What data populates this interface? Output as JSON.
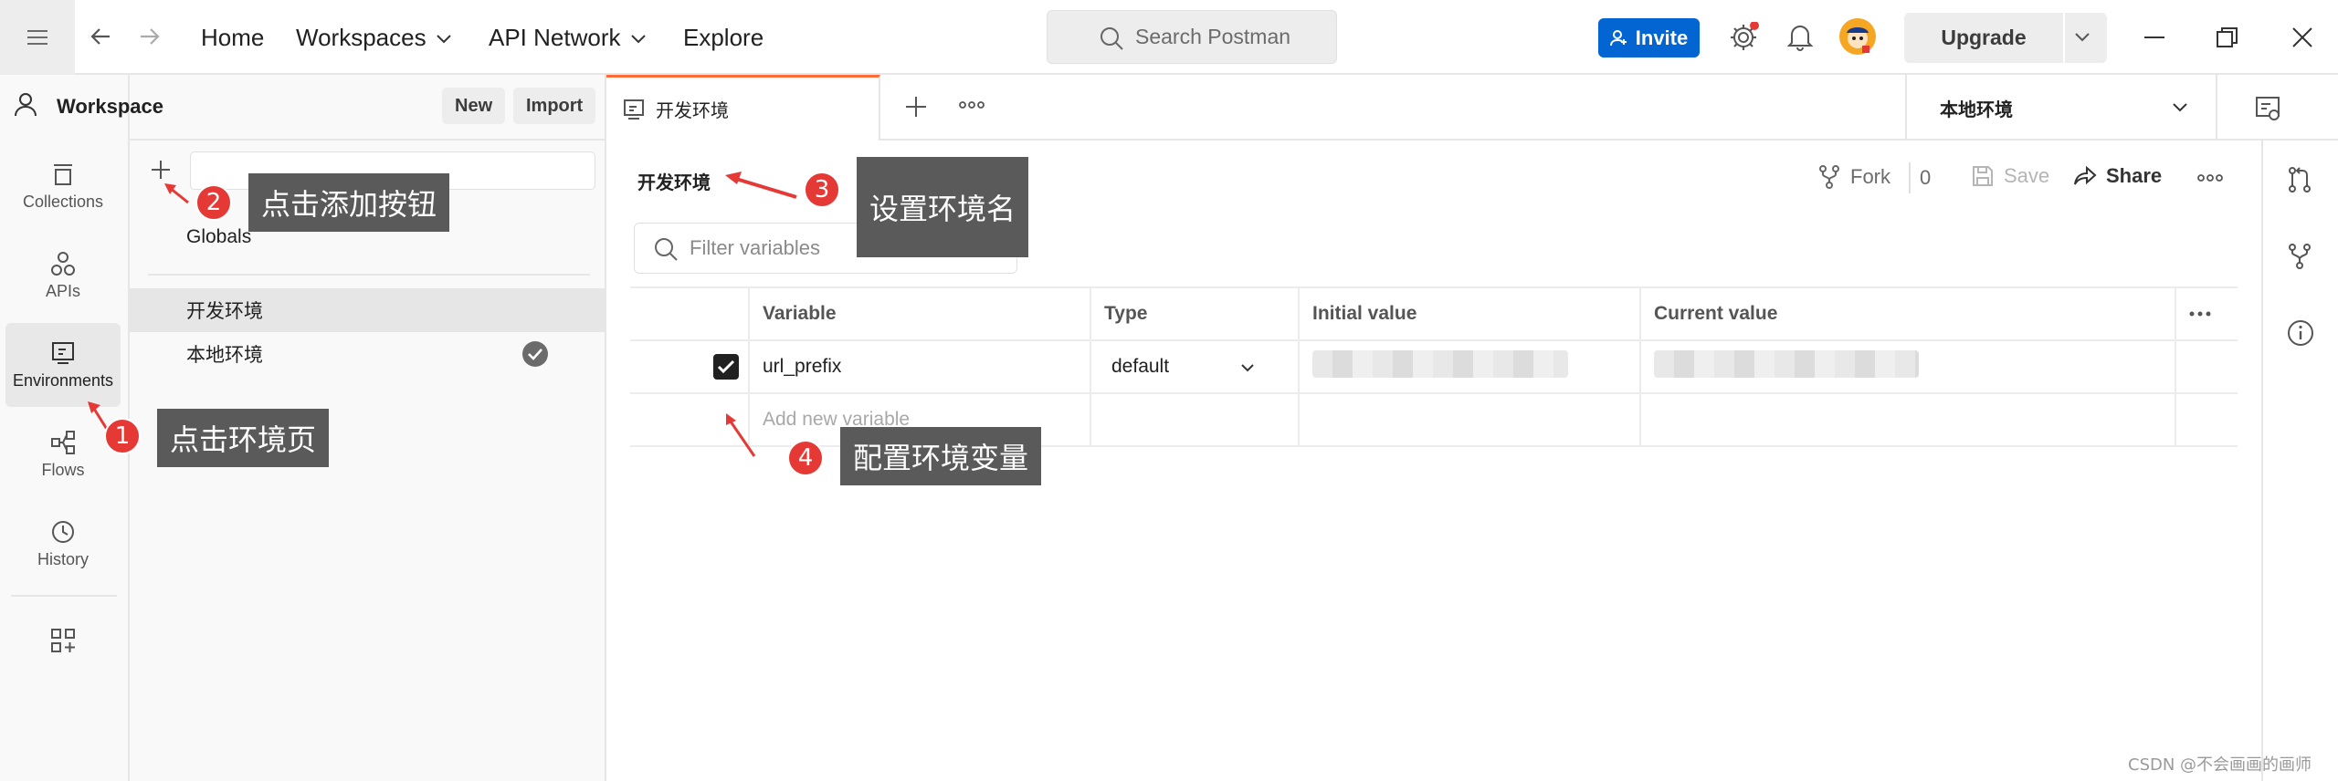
{
  "topbar": {
    "nav": [
      "Home",
      "Workspaces",
      "API Network",
      "Explore"
    ],
    "search_placeholder": "Search Postman",
    "invite_label": "Invite",
    "upgrade_label": "Upgrade",
    "accent_color": "#ff6c37",
    "invite_color": "#0265d2"
  },
  "sidebar": {
    "workspace_label": "Workspace",
    "new_label": "New",
    "import_label": "Import",
    "rail": [
      {
        "label": "Collections",
        "icon": "collections-icon"
      },
      {
        "label": "APIs",
        "icon": "apis-icon"
      },
      {
        "label": "Environments",
        "icon": "environments-icon",
        "active": true
      },
      {
        "label": "Flows",
        "icon": "flows-icon"
      },
      {
        "label": "History",
        "icon": "history-icon"
      }
    ],
    "globals_label": "Globals",
    "environments": [
      {
        "name": "开发环境",
        "selected": true,
        "active": false
      },
      {
        "name": "本地环境",
        "selected": false,
        "active": true
      }
    ]
  },
  "tabs": {
    "active_tab": "开发环境",
    "env_select": "本地环境"
  },
  "main": {
    "title": "开发环境",
    "fork_label": "Fork",
    "fork_count": "0",
    "save_label": "Save",
    "share_label": "Share",
    "filter_placeholder": "Filter variables",
    "columns": [
      "Variable",
      "Type",
      "Initial value",
      "Current value"
    ],
    "rows": [
      {
        "checked": true,
        "variable": "url_prefix",
        "type": "default"
      }
    ],
    "add_placeholder": "Add new variable"
  },
  "annotations": [
    {
      "num": "1",
      "text": "点击环境页"
    },
    {
      "num": "2",
      "text": "点击添加按钮"
    },
    {
      "num": "3",
      "text": "设置环境名"
    },
    {
      "num": "4",
      "text": "配置环境变量"
    }
  ],
  "watermark": "CSDN @不会画画的画师"
}
